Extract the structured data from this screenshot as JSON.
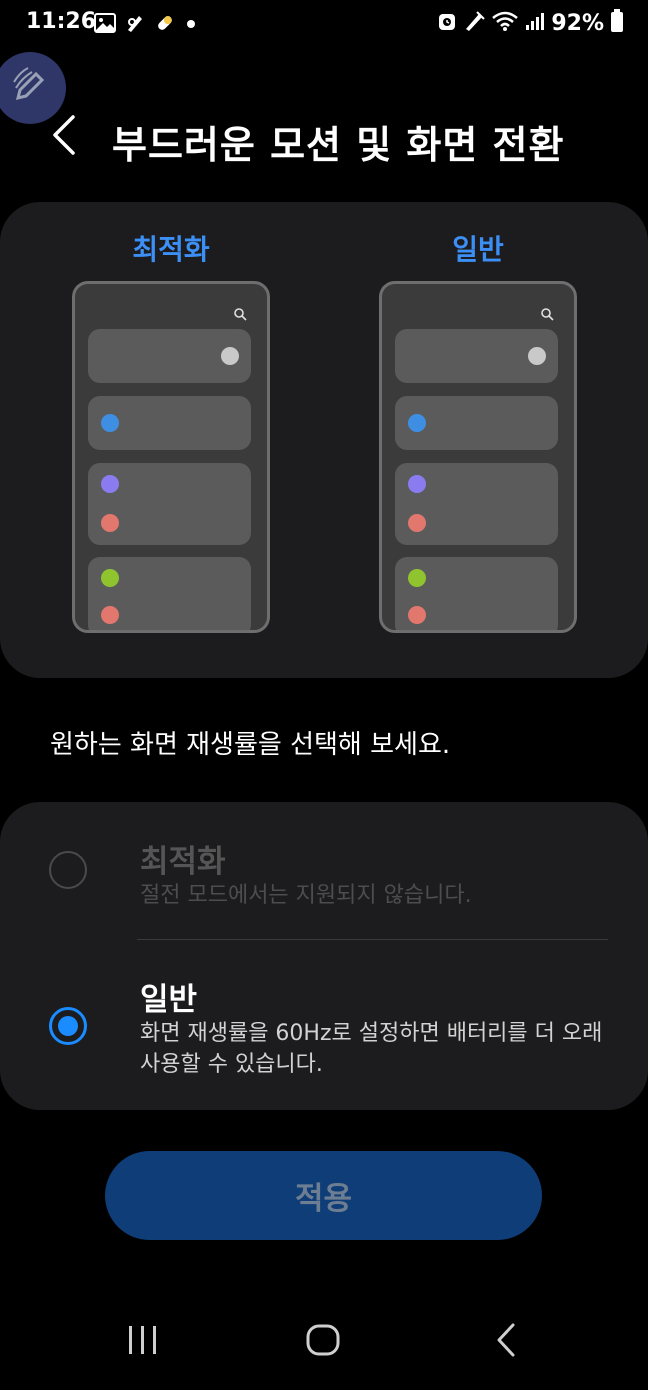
{
  "status_bar": {
    "time": "11:26",
    "battery": "92%",
    "left_icons": [
      "gallery-icon",
      "pen-settings-icon",
      "pill-icon",
      "dot-icon"
    ],
    "right_icons": [
      "alarm-icon",
      "pen-icon",
      "wifi-icon",
      "signal-icon",
      "battery-icon"
    ]
  },
  "header": {
    "title": "부드러운 모션 및 화면 전환"
  },
  "preview": {
    "optimized_label": "최적화",
    "standard_label": "일반"
  },
  "instruction": "원하는 화면 재생률을 선택해 보세요.",
  "options": [
    {
      "title": "최적화",
      "description": "절전 모드에서는 지원되지 않습니다.",
      "selected": false,
      "enabled": false
    },
    {
      "title": "일반",
      "description": "화면 재생률을 60Hz로 설정하면 배터리를 더 오래 사용할 수 있습니다.",
      "selected": true,
      "enabled": true
    }
  ],
  "apply_button": {
    "label": "적용",
    "enabled": false
  },
  "colors": {
    "accent": "#1a8cff",
    "label_blue": "#3c8ff5",
    "card_bg": "#1c1c1e",
    "button_bg": "#0e3d77",
    "dot_blue": "#3e8fe3",
    "dot_purple": "#8a7cf0",
    "dot_salmon": "#e1776d",
    "dot_green": "#8fc42f",
    "dot_gray": "#c9c9c9"
  }
}
